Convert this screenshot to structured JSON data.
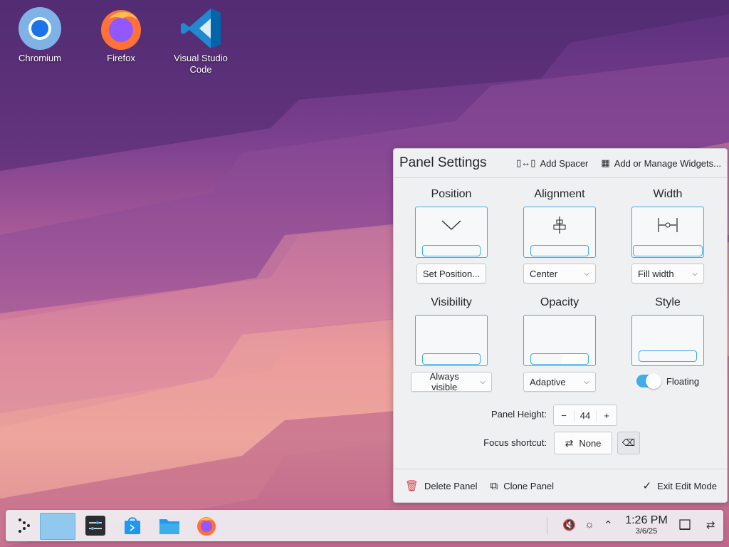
{
  "desktop": {
    "icons": [
      {
        "label": "Chromium",
        "icon": "chromium-icon"
      },
      {
        "label": "Firefox",
        "icon": "firefox-icon"
      },
      {
        "label": "Visual Studio Code",
        "icon": "vscode-icon"
      }
    ]
  },
  "panel_settings": {
    "title": "Panel Settings",
    "add_spacer": "Add Spacer",
    "add_widgets": "Add or Manage Widgets...",
    "position": {
      "title": "Position",
      "button": "Set Position..."
    },
    "alignment": {
      "title": "Alignment",
      "value": "Center"
    },
    "width": {
      "title": "Width",
      "value": "Fill width"
    },
    "visibility": {
      "title": "Visibility",
      "value": "Always visible"
    },
    "opacity": {
      "title": "Opacity",
      "value": "Adaptive"
    },
    "style": {
      "title": "Style",
      "toggle_label": "Floating",
      "toggle_on": true
    },
    "panel_height": {
      "label": "Panel Height:",
      "value": "44",
      "minus": "−",
      "plus": "+"
    },
    "focus_shortcut": {
      "label": "Focus shortcut:",
      "value": "None"
    },
    "footer": {
      "delete": "Delete Panel",
      "clone": "Clone Panel",
      "exit": "Exit Edit Mode"
    }
  },
  "taskbar": {
    "clock_time": "1:26 PM",
    "clock_date": "3/6/25",
    "accent": "#3daee9"
  }
}
